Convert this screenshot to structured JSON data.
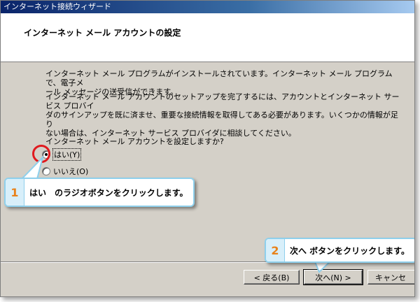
{
  "window": {
    "title": "インターネット接続ウィザード"
  },
  "header": {
    "title": "インターネット メール アカウントの設定"
  },
  "content": {
    "paragraph1_line1": "インターネット メール プログラムがインストールされています。インターネット メール プログラムで、電子メ",
    "paragraph1_line2": "ール メッセージの送受信ができます。",
    "paragraph2_line1": "インターネット メール アカウントのセットアップを完了するには、アカウントとインターネット サービス プロバイ",
    "paragraph2_line2": "ダのサインアップを既に済ませ、重要な接続情報を取得してある必要があります。いくつかの情報が足り",
    "paragraph2_line3": "ない場合は、インターネット サービス プロバイダに相談してください。",
    "question": "インターネット メール アカウントを設定しますか?",
    "options": [
      {
        "label": "はい(Y)",
        "selected": true
      },
      {
        "label": "いいえ(O)",
        "selected": false
      }
    ]
  },
  "buttons": {
    "back": "< 戻る(B)",
    "next": "次へ(N) >",
    "cancel": "キャンセ"
  },
  "callouts": [
    {
      "number": "1",
      "text": "はい　のラジオボタンをクリックします。"
    },
    {
      "number": "2",
      "text": "次へ ボタンをクリックします。"
    }
  ],
  "colors": {
    "highlight_ring": "#e0191e",
    "callout_border": "#8fd0ec",
    "callout_number": "#e8821a"
  }
}
